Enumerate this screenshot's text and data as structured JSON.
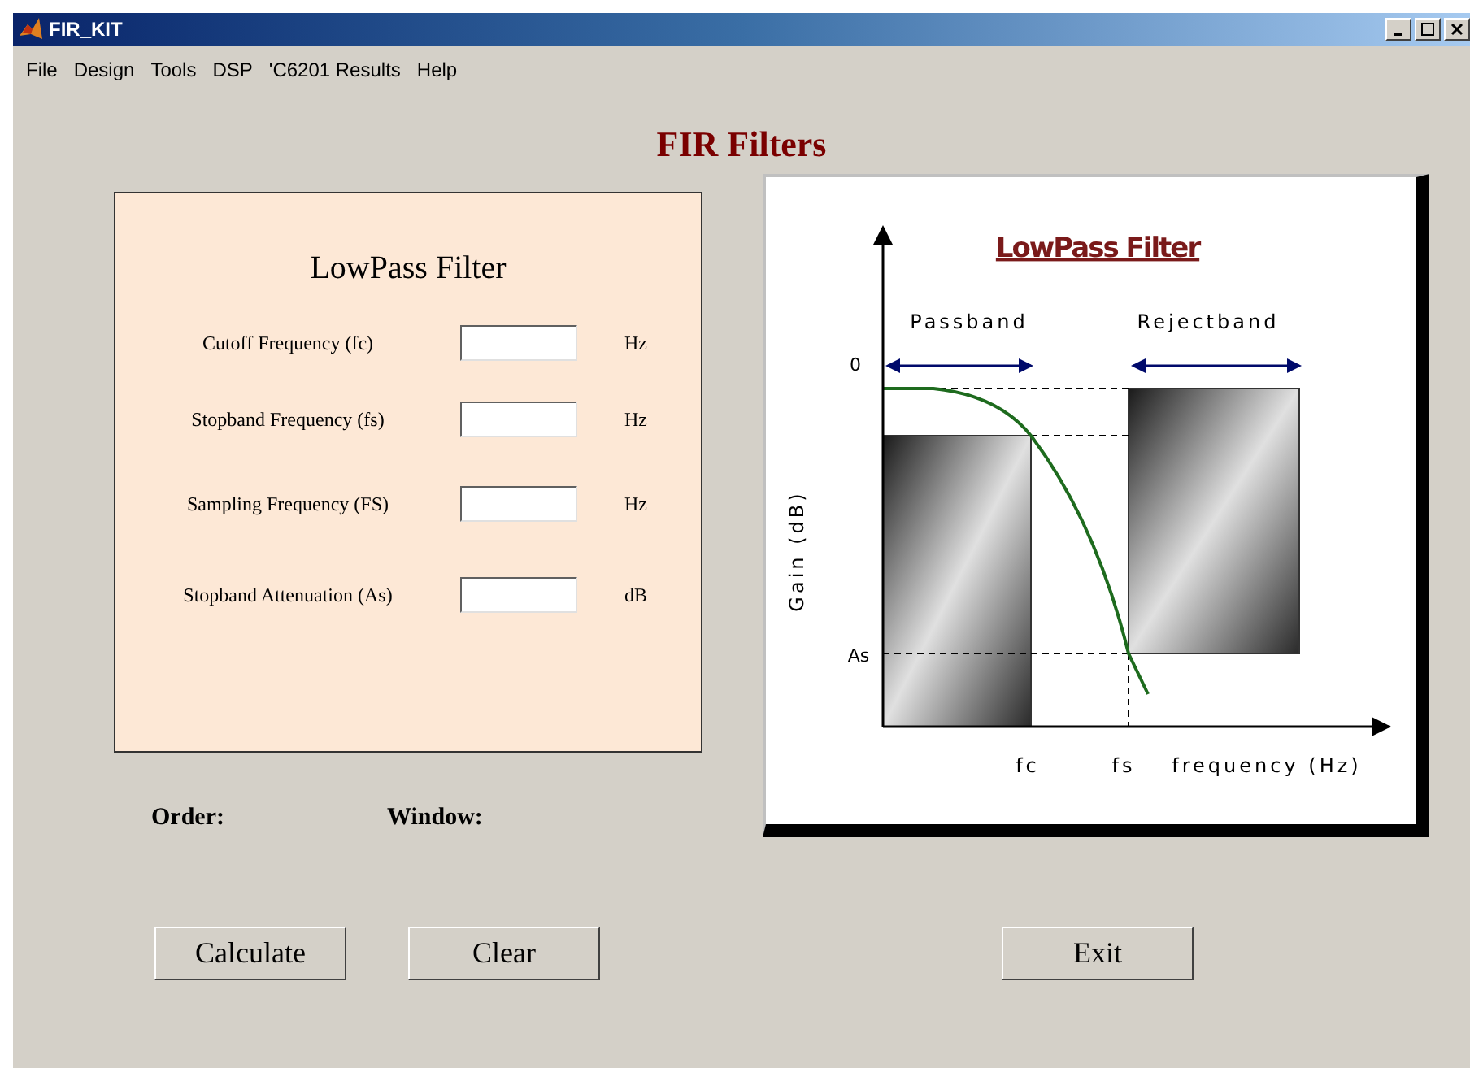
{
  "window": {
    "title": "FIR_KIT"
  },
  "menu": [
    "File",
    "Design",
    "Tools",
    "DSP",
    "'C6201 Results",
    "Help"
  ],
  "heading": "FIR Filters",
  "form": {
    "title": "LowPass Filter",
    "fields": [
      {
        "label": "Cutoff Frequency (fc)",
        "unit": "Hz"
      },
      {
        "label": "Stopband Frequency (fs)",
        "unit": "Hz"
      },
      {
        "label": "Sampling Frequency (FS)",
        "unit": "Hz"
      },
      {
        "label": "Stopband Attenuation (As)",
        "unit": "dB"
      }
    ]
  },
  "results": [
    {
      "label": "Order:"
    },
    {
      "label": "Window:"
    }
  ],
  "diagram": {
    "title": "LowPass Filter",
    "passband": "Passband",
    "rejectband": "Rejectband",
    "zero": "0",
    "as": "As",
    "ylabel": "Gain (dB)",
    "fc": "fc",
    "fs": "fs",
    "xlabel": "frequency (Hz)"
  },
  "buttons": [
    "Calculate",
    "Clear",
    "Exit"
  ]
}
